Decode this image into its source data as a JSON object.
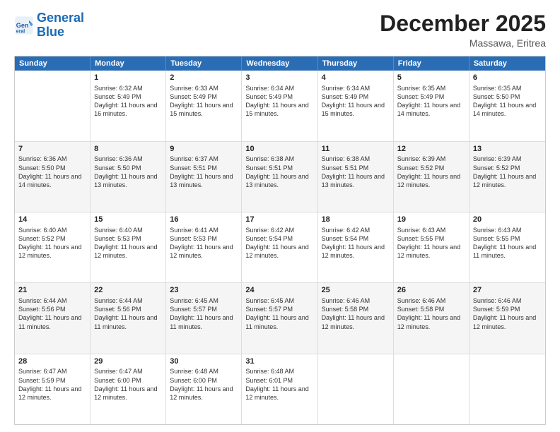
{
  "logo": {
    "line1": "General",
    "line2": "Blue"
  },
  "title": "December 2025",
  "location": "Massawa, Eritrea",
  "days_of_week": [
    "Sunday",
    "Monday",
    "Tuesday",
    "Wednesday",
    "Thursday",
    "Friday",
    "Saturday"
  ],
  "weeks": [
    [
      {
        "day": "",
        "sunrise": "",
        "sunset": "",
        "daylight": ""
      },
      {
        "day": "1",
        "sunrise": "Sunrise: 6:32 AM",
        "sunset": "Sunset: 5:49 PM",
        "daylight": "Daylight: 11 hours and 16 minutes."
      },
      {
        "day": "2",
        "sunrise": "Sunrise: 6:33 AM",
        "sunset": "Sunset: 5:49 PM",
        "daylight": "Daylight: 11 hours and 15 minutes."
      },
      {
        "day": "3",
        "sunrise": "Sunrise: 6:34 AM",
        "sunset": "Sunset: 5:49 PM",
        "daylight": "Daylight: 11 hours and 15 minutes."
      },
      {
        "day": "4",
        "sunrise": "Sunrise: 6:34 AM",
        "sunset": "Sunset: 5:49 PM",
        "daylight": "Daylight: 11 hours and 15 minutes."
      },
      {
        "day": "5",
        "sunrise": "Sunrise: 6:35 AM",
        "sunset": "Sunset: 5:49 PM",
        "daylight": "Daylight: 11 hours and 14 minutes."
      },
      {
        "day": "6",
        "sunrise": "Sunrise: 6:35 AM",
        "sunset": "Sunset: 5:50 PM",
        "daylight": "Daylight: 11 hours and 14 minutes."
      }
    ],
    [
      {
        "day": "7",
        "sunrise": "Sunrise: 6:36 AM",
        "sunset": "Sunset: 5:50 PM",
        "daylight": "Daylight: 11 hours and 14 minutes."
      },
      {
        "day": "8",
        "sunrise": "Sunrise: 6:36 AM",
        "sunset": "Sunset: 5:50 PM",
        "daylight": "Daylight: 11 hours and 13 minutes."
      },
      {
        "day": "9",
        "sunrise": "Sunrise: 6:37 AM",
        "sunset": "Sunset: 5:51 PM",
        "daylight": "Daylight: 11 hours and 13 minutes."
      },
      {
        "day": "10",
        "sunrise": "Sunrise: 6:38 AM",
        "sunset": "Sunset: 5:51 PM",
        "daylight": "Daylight: 11 hours and 13 minutes."
      },
      {
        "day": "11",
        "sunrise": "Sunrise: 6:38 AM",
        "sunset": "Sunset: 5:51 PM",
        "daylight": "Daylight: 11 hours and 13 minutes."
      },
      {
        "day": "12",
        "sunrise": "Sunrise: 6:39 AM",
        "sunset": "Sunset: 5:52 PM",
        "daylight": "Daylight: 11 hours and 12 minutes."
      },
      {
        "day": "13",
        "sunrise": "Sunrise: 6:39 AM",
        "sunset": "Sunset: 5:52 PM",
        "daylight": "Daylight: 11 hours and 12 minutes."
      }
    ],
    [
      {
        "day": "14",
        "sunrise": "Sunrise: 6:40 AM",
        "sunset": "Sunset: 5:52 PM",
        "daylight": "Daylight: 11 hours and 12 minutes."
      },
      {
        "day": "15",
        "sunrise": "Sunrise: 6:40 AM",
        "sunset": "Sunset: 5:53 PM",
        "daylight": "Daylight: 11 hours and 12 minutes."
      },
      {
        "day": "16",
        "sunrise": "Sunrise: 6:41 AM",
        "sunset": "Sunset: 5:53 PM",
        "daylight": "Daylight: 11 hours and 12 minutes."
      },
      {
        "day": "17",
        "sunrise": "Sunrise: 6:42 AM",
        "sunset": "Sunset: 5:54 PM",
        "daylight": "Daylight: 11 hours and 12 minutes."
      },
      {
        "day": "18",
        "sunrise": "Sunrise: 6:42 AM",
        "sunset": "Sunset: 5:54 PM",
        "daylight": "Daylight: 11 hours and 12 minutes."
      },
      {
        "day": "19",
        "sunrise": "Sunrise: 6:43 AM",
        "sunset": "Sunset: 5:55 PM",
        "daylight": "Daylight: 11 hours and 12 minutes."
      },
      {
        "day": "20",
        "sunrise": "Sunrise: 6:43 AM",
        "sunset": "Sunset: 5:55 PM",
        "daylight": "Daylight: 11 hours and 11 minutes."
      }
    ],
    [
      {
        "day": "21",
        "sunrise": "Sunrise: 6:44 AM",
        "sunset": "Sunset: 5:56 PM",
        "daylight": "Daylight: 11 hours and 11 minutes."
      },
      {
        "day": "22",
        "sunrise": "Sunrise: 6:44 AM",
        "sunset": "Sunset: 5:56 PM",
        "daylight": "Daylight: 11 hours and 11 minutes."
      },
      {
        "day": "23",
        "sunrise": "Sunrise: 6:45 AM",
        "sunset": "Sunset: 5:57 PM",
        "daylight": "Daylight: 11 hours and 11 minutes."
      },
      {
        "day": "24",
        "sunrise": "Sunrise: 6:45 AM",
        "sunset": "Sunset: 5:57 PM",
        "daylight": "Daylight: 11 hours and 11 minutes."
      },
      {
        "day": "25",
        "sunrise": "Sunrise: 6:46 AM",
        "sunset": "Sunset: 5:58 PM",
        "daylight": "Daylight: 11 hours and 12 minutes."
      },
      {
        "day": "26",
        "sunrise": "Sunrise: 6:46 AM",
        "sunset": "Sunset: 5:58 PM",
        "daylight": "Daylight: 11 hours and 12 minutes."
      },
      {
        "day": "27",
        "sunrise": "Sunrise: 6:46 AM",
        "sunset": "Sunset: 5:59 PM",
        "daylight": "Daylight: 11 hours and 12 minutes."
      }
    ],
    [
      {
        "day": "28",
        "sunrise": "Sunrise: 6:47 AM",
        "sunset": "Sunset: 5:59 PM",
        "daylight": "Daylight: 11 hours and 12 minutes."
      },
      {
        "day": "29",
        "sunrise": "Sunrise: 6:47 AM",
        "sunset": "Sunset: 6:00 PM",
        "daylight": "Daylight: 11 hours and 12 minutes."
      },
      {
        "day": "30",
        "sunrise": "Sunrise: 6:48 AM",
        "sunset": "Sunset: 6:00 PM",
        "daylight": "Daylight: 11 hours and 12 minutes."
      },
      {
        "day": "31",
        "sunrise": "Sunrise: 6:48 AM",
        "sunset": "Sunset: 6:01 PM",
        "daylight": "Daylight: 11 hours and 12 minutes."
      },
      {
        "day": "",
        "sunrise": "",
        "sunset": "",
        "daylight": ""
      },
      {
        "day": "",
        "sunrise": "",
        "sunset": "",
        "daylight": ""
      },
      {
        "day": "",
        "sunrise": "",
        "sunset": "",
        "daylight": ""
      }
    ]
  ]
}
